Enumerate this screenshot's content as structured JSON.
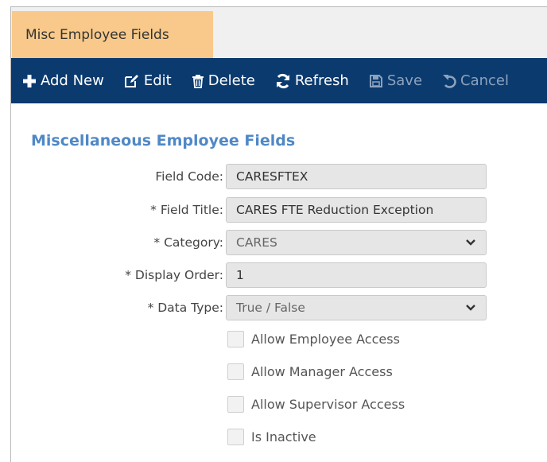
{
  "tab": {
    "label": "Misc Employee Fields"
  },
  "toolbar": {
    "add_new": "Add New",
    "edit": "Edit",
    "delete": "Delete",
    "refresh": "Refresh",
    "save": "Save",
    "cancel": "Cancel"
  },
  "form": {
    "title": "Miscellaneous Employee Fields",
    "field_code": {
      "label": "Field Code:",
      "value": "CARESFTEX"
    },
    "field_title": {
      "label": "* Field Title:",
      "value": "CARES FTE Reduction Exception"
    },
    "category": {
      "label": "* Category:",
      "value": "CARES"
    },
    "display_order": {
      "label": "* Display Order:",
      "value": "1"
    },
    "data_type": {
      "label": "* Data Type:",
      "value": "True / False"
    },
    "checkboxes": [
      {
        "label": "Allow Employee Access",
        "checked": false
      },
      {
        "label": "Allow Manager Access",
        "checked": false
      },
      {
        "label": "Allow Supervisor Access",
        "checked": false
      },
      {
        "label": "Is Inactive",
        "checked": false
      }
    ]
  },
  "colors": {
    "tab_active": "#f8c98a",
    "toolbar_bg": "#0b3a6e",
    "section_title": "#4f88c6",
    "disabled_button": "#8ca2bd"
  },
  "icons": [
    "plus-icon",
    "edit-icon",
    "trash-icon",
    "refresh-icon",
    "save-icon",
    "undo-icon",
    "chevron-down-icon"
  ]
}
